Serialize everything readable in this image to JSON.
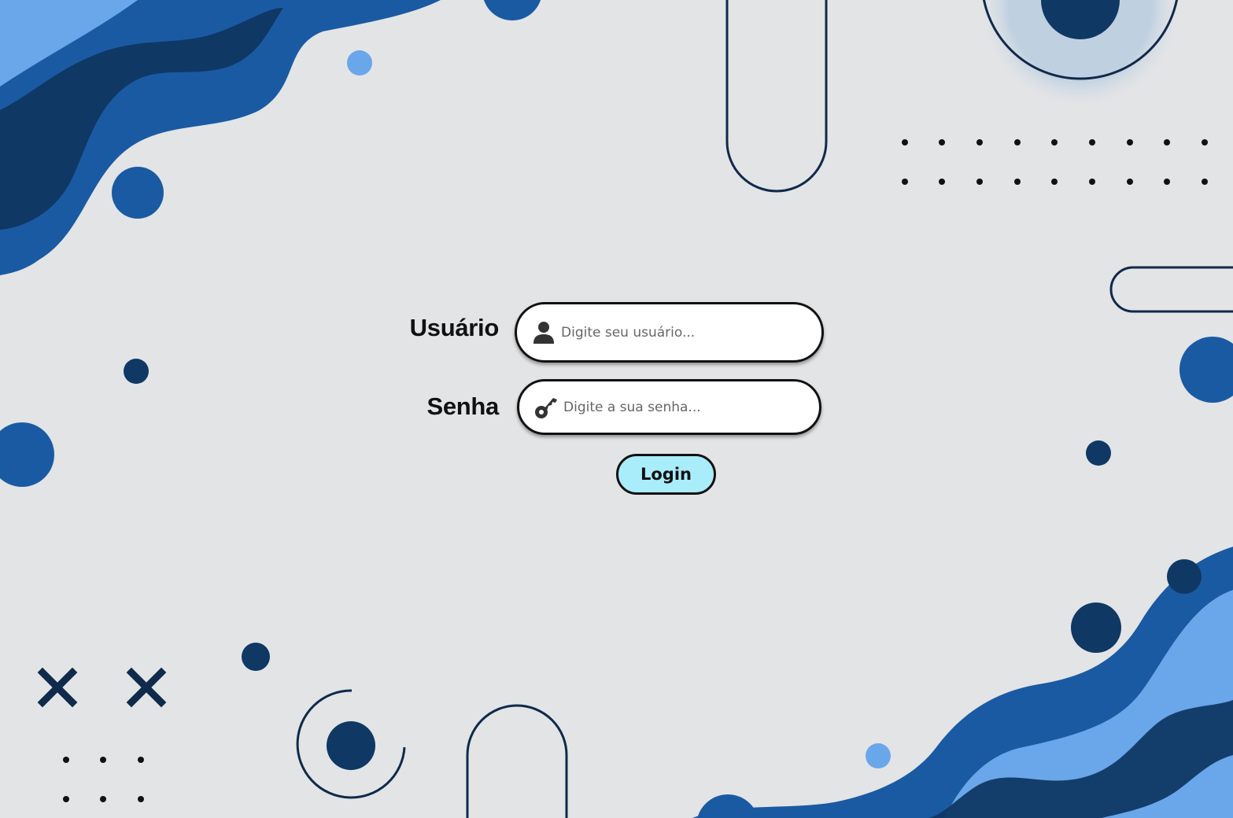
{
  "login_form": {
    "username": {
      "label": "Usuário",
      "placeholder": "Digite seu usuário...",
      "value": "",
      "icon": "user-icon"
    },
    "password": {
      "label": "Senha",
      "placeholder": "Digite a sua senha...",
      "value": "",
      "icon": "key-icon"
    },
    "submit_label": "Login"
  },
  "colors": {
    "background": "#e3e4e6",
    "dark_blue": "#0f3864",
    "mid_blue": "#1a5aa3",
    "light_blue": "#6aa6ea",
    "button_fill": "#a9ecfa",
    "outline": "#111111"
  }
}
